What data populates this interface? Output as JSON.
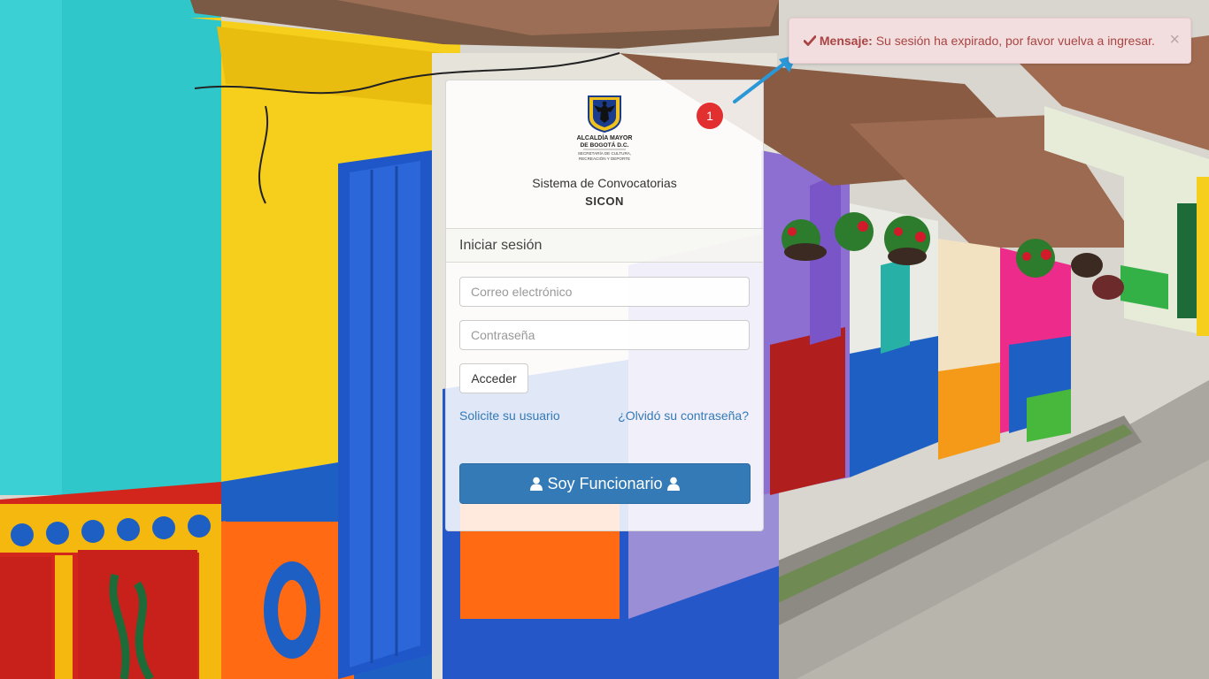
{
  "login": {
    "logo_line1": "ALCALDÍA MAYOR",
    "logo_line2": "DE BOGOTÁ D.C.",
    "logo_line3": "SECRETARÍA DE CULTURA,",
    "logo_line4": "RECREACIÓN Y DEPORTE",
    "system_name": "Sistema de Convocatorias",
    "system_code": "SICON",
    "heading": "Iniciar sesión",
    "email_placeholder": "Correo electrónico",
    "password_placeholder": "Contraseña",
    "submit_label": "Acceder",
    "request_user_link": "Solicite su usuario",
    "forgot_password_link": "¿Olvidó su contraseña?",
    "official_button": "Soy Funcionario"
  },
  "badge": {
    "number": "1",
    "color": "#e22f2f"
  },
  "toast": {
    "label": "Mensaje:",
    "message": "Su sesión ha expirado, por favor vuelva a ingresar.",
    "close": "×",
    "bg_color": "#f2dede",
    "text_color": "#a94442"
  },
  "icons": {
    "toast_icon": "check-icon",
    "button_icons": "user-icon",
    "close": "close-icon"
  },
  "colors": {
    "primary": "#337ab7",
    "link": "#337ab7"
  }
}
